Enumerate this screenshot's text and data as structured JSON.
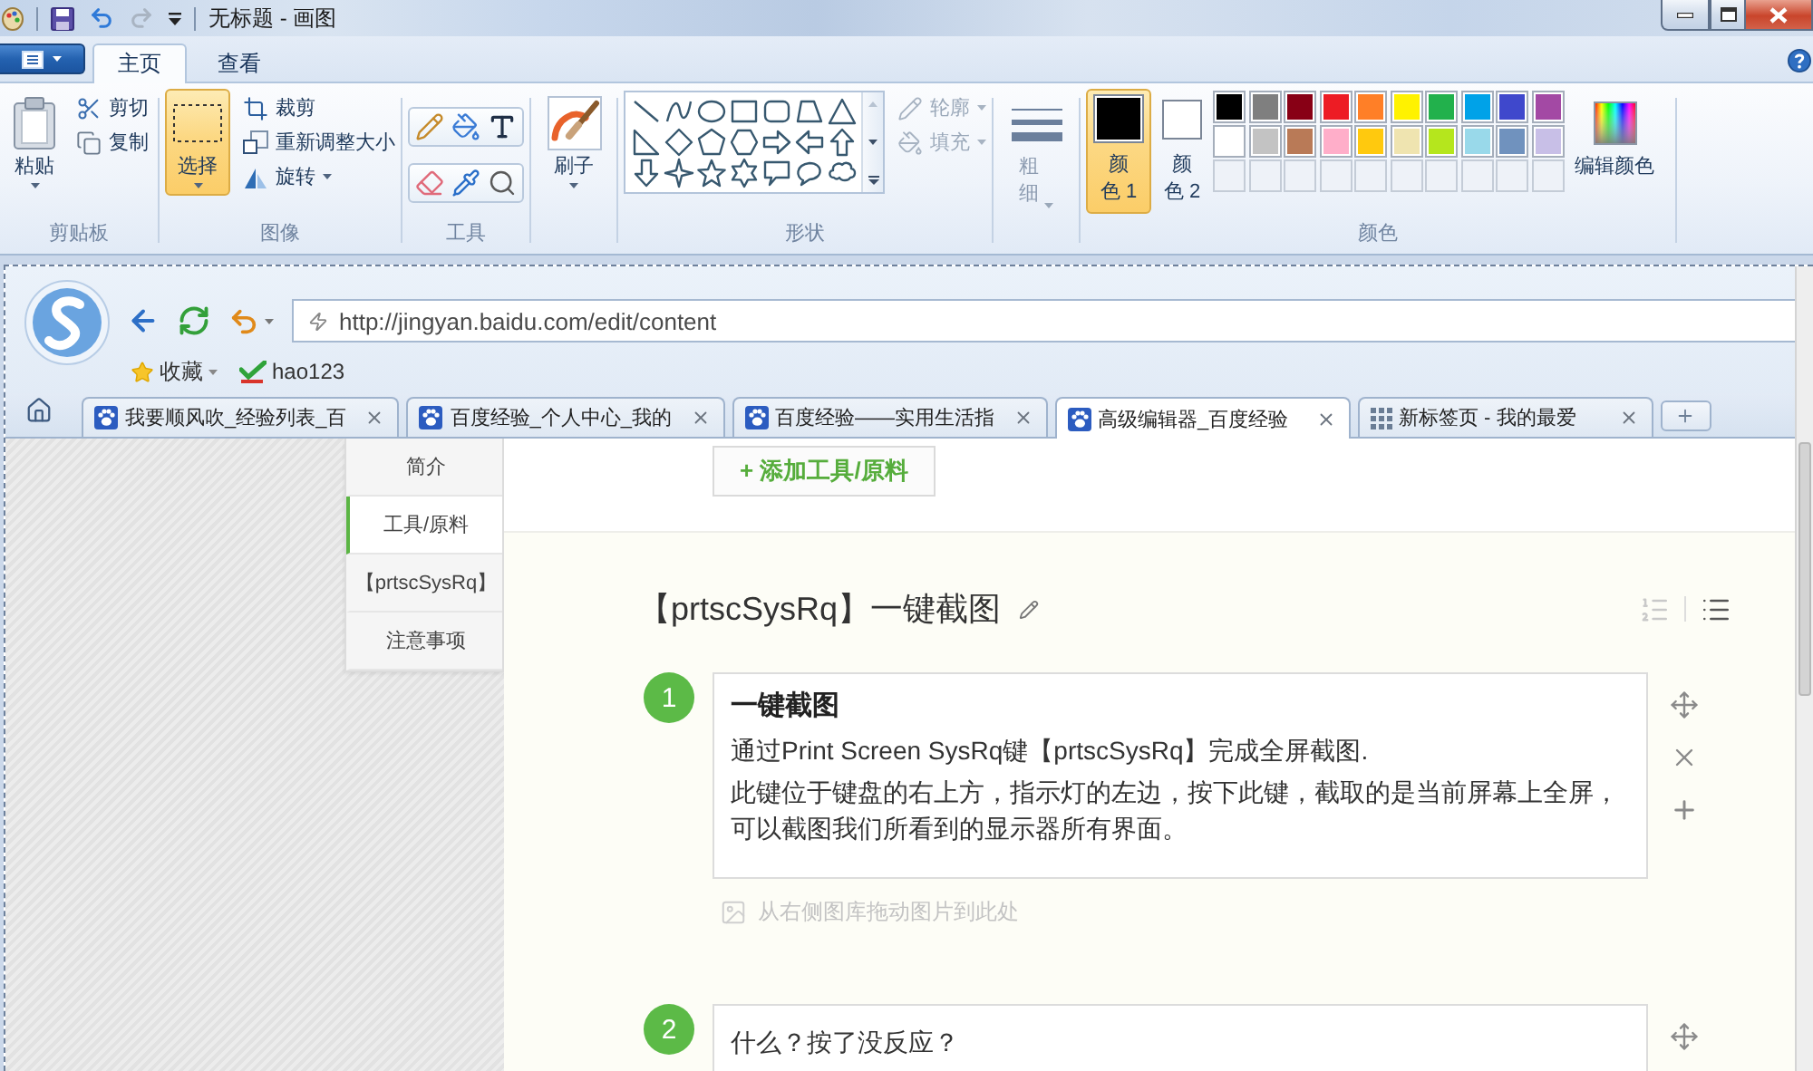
{
  "window": {
    "title": "无标题 - 画图"
  },
  "ribbon_tabs": [
    {
      "label": "主页",
      "selected": true
    },
    {
      "label": "查看",
      "selected": false
    }
  ],
  "ribbon_groups": [
    {
      "kind": "clipboard",
      "label": "剪贴板",
      "large": {
        "label": "粘贴",
        "selected": false
      },
      "items": [
        {
          "kind": "cut",
          "label": "剪切",
          "disabled": false,
          "menu": false
        },
        {
          "kind": "copy",
          "label": "复制",
          "disabled": false,
          "menu": false
        }
      ]
    },
    {
      "kind": "image",
      "label": "图像",
      "large": {
        "label": "选择",
        "selected": true
      },
      "items": [
        {
          "kind": "crop",
          "label": "裁剪",
          "disabled": false,
          "menu": false
        },
        {
          "kind": "resize",
          "label": "重新调整大小",
          "disabled": false,
          "menu": false
        },
        {
          "kind": "rotate",
          "label": "旋转",
          "disabled": false,
          "menu": true
        }
      ]
    },
    {
      "kind": "tools",
      "label": "工具"
    },
    {
      "kind": "brushes",
      "large": {
        "label": "刷子",
        "selected": false
      }
    },
    {
      "kind": "shapes",
      "label": "形状",
      "items": [
        {
          "kind": "outline",
          "label": "轮廓",
          "disabled": true,
          "menu": true
        },
        {
          "kind": "fill",
          "label": "填充",
          "disabled": true,
          "menu": true
        }
      ]
    },
    {
      "kind": "size",
      "large": {
        "label": "粗细",
        "disabled": true
      }
    },
    {
      "kind": "colors",
      "label": "颜色",
      "current": [
        {
          "label": "颜色 1",
          "color": "#000000",
          "selected": true
        },
        {
          "label": "颜色 2",
          "color": "#ffffff",
          "selected": false
        }
      ],
      "palette": [
        {
          "kind": "swatch",
          "color": "#000000"
        },
        {
          "kind": "swatch",
          "color": "#7f7f7f"
        },
        {
          "kind": "swatch",
          "color": "#880015"
        },
        {
          "kind": "swatch",
          "color": "#ed1c24"
        },
        {
          "kind": "swatch",
          "color": "#ff7f27"
        },
        {
          "kind": "swatch",
          "color": "#fff200"
        },
        {
          "kind": "swatch",
          "color": "#22b14c"
        },
        {
          "kind": "swatch",
          "color": "#00a2e8"
        },
        {
          "kind": "swatch",
          "color": "#3f48cc"
        },
        {
          "kind": "swatch",
          "color": "#a349a4"
        },
        {
          "kind": "swatch",
          "color": "#ffffff"
        },
        {
          "kind": "swatch",
          "color": "#c3c3c3"
        },
        {
          "kind": "swatch",
          "color": "#b97a57"
        },
        {
          "kind": "swatch",
          "color": "#ffaec9"
        },
        {
          "kind": "swatch",
          "color": "#ffc90e"
        },
        {
          "kind": "swatch",
          "color": "#efe4b0"
        },
        {
          "kind": "swatch",
          "color": "#b5e61d"
        },
        {
          "kind": "swatch",
          "color": "#99d9ea"
        },
        {
          "kind": "swatch",
          "color": "#7092be"
        },
        {
          "kind": "swatch",
          "color": "#c8bfe7"
        },
        {
          "kind": "empty"
        },
        {
          "kind": "empty"
        },
        {
          "kind": "empty"
        },
        {
          "kind": "empty"
        },
        {
          "kind": "empty"
        },
        {
          "kind": "empty"
        },
        {
          "kind": "empty"
        },
        {
          "kind": "empty"
        },
        {
          "kind": "empty"
        },
        {
          "kind": "empty"
        }
      ],
      "edit": {
        "label": "编辑颜色"
      }
    }
  ],
  "browser": {
    "url": "http://jingyan.baidu.com/edit/content",
    "bookmarks": [
      {
        "kind": "favorites",
        "label": "收藏"
      },
      {
        "kind": "site",
        "label": "hao123"
      }
    ],
    "tabs": [
      {
        "kind": "page",
        "title": "我要顺风吹_经验列表_百",
        "selected": false
      },
      {
        "kind": "page",
        "title": "百度经验_个人中心_我的",
        "selected": false
      },
      {
        "kind": "page",
        "title": "百度经验——实用生活指",
        "selected": false
      },
      {
        "kind": "page",
        "title": "高级编辑器_百度经验",
        "selected": true
      },
      {
        "kind": "new_tab",
        "title": "新标签页 - 我的最爱",
        "selected": false
      }
    ]
  },
  "page": {
    "nav": [
      {
        "label": "简介",
        "selected": false
      },
      {
        "label": "工具/原料",
        "selected": true
      },
      {
        "label": "【prtscSysRq】",
        "selected": false
      },
      {
        "label": "注意事项",
        "selected": false
      }
    ],
    "add_button": "+ 添加工具/原料",
    "title": "【prtscSysRq】一键截图",
    "steps": [
      {
        "number": "1",
        "heading": "一键截图",
        "paragraphs": [
          "通过Print Screen SysRq键【prtscSysRq】完成全屏截图.",
          "此键位于键盘的右上方，指示灯的左边，按下此键，截取的是当前屏幕上全屏，可以截图我们所看到的显示器所有界面。"
        ],
        "image_hint": "从右侧图库拖动图片到此处"
      },
      {
        "number": "2",
        "paragraphs": [
          "什么？按了没反应？"
        ]
      }
    ]
  }
}
